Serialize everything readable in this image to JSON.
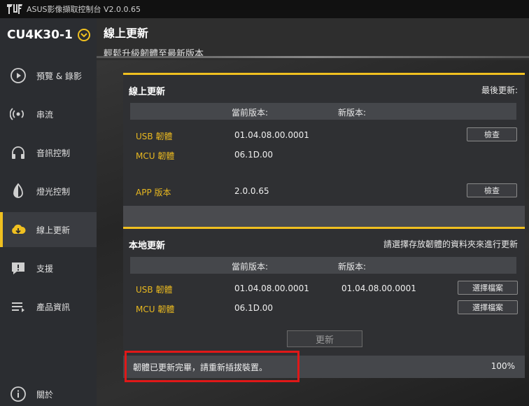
{
  "window": {
    "title": "ASUS影像擷取控制台 V2.0.0.65"
  },
  "sidebar": {
    "model": "CU4K30-1",
    "items": [
      {
        "label": "預覽 & 錄影",
        "icon": "play-icon"
      },
      {
        "label": "串流",
        "icon": "broadcast-icon"
      },
      {
        "label": "音訊控制",
        "icon": "headphones-icon"
      },
      {
        "label": "燈光控制",
        "icon": "light-icon"
      },
      {
        "label": "線上更新",
        "icon": "cloud-download-icon",
        "active": true
      },
      {
        "label": "支援",
        "icon": "alert-icon"
      },
      {
        "label": "產品資訊",
        "icon": "list-icon"
      }
    ],
    "about": {
      "label": "關於",
      "icon": "info-icon"
    }
  },
  "page": {
    "title": "線上更新",
    "subtitle": "輕鬆升級韌體至最新版本"
  },
  "online": {
    "title": "線上更新",
    "last_update_label": "最後更新:",
    "col_current": "當前版本:",
    "col_new": "新版本:",
    "rows": [
      {
        "label": "USB 韌體",
        "current": "01.04.08.00.0001",
        "button": "檢查"
      },
      {
        "label": "MCU 韌體",
        "current": "06.1D.00"
      },
      {
        "label": "APP 版本",
        "current": "2.0.0.65",
        "button": "檢查"
      }
    ]
  },
  "local": {
    "title": "本地更新",
    "hint": "請選擇存放韌體的資料夾來進行更新",
    "col_current": "當前版本:",
    "col_new": "新版本:",
    "rows": [
      {
        "label": "USB 韌體",
        "current": "01.04.08.00.0001",
        "new": "01.04.08.00.0001",
        "button": "選擇檔案"
      },
      {
        "label": "MCU 韌體",
        "current": "06.1D.00",
        "button": "選擇檔案"
      }
    ],
    "update_button": "更新"
  },
  "status": {
    "message": "韌體已更新完畢，請重新插拔裝置。",
    "progress": "100%"
  },
  "colors": {
    "accent": "#f0c020",
    "highlight": "#e01818",
    "label": "#e8b820"
  }
}
